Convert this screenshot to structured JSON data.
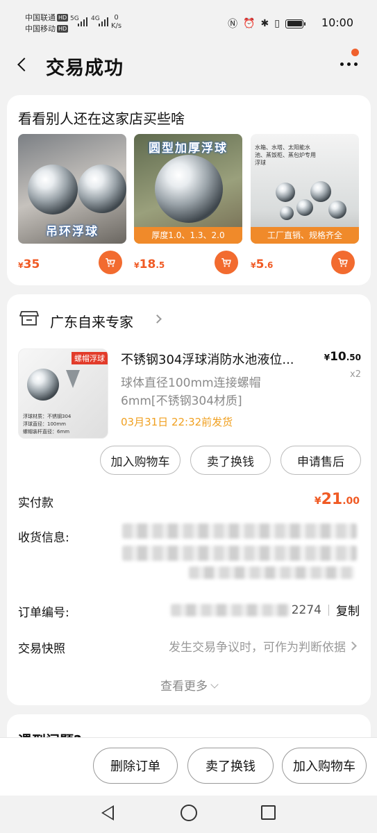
{
  "status_bar": {
    "carrier1": "中国联通",
    "carrier2": "中国移动",
    "hd": "HD",
    "net1": "5G",
    "net2": "4G",
    "speed_value": "0",
    "speed_unit": "K/s",
    "time": "10:00",
    "icons": [
      "nfc-icon",
      "alarm-icon",
      "bluetooth-icon",
      "vibrate-icon",
      "battery-icon"
    ]
  },
  "header": {
    "title": "交易成功",
    "back_icon": "back-chevron-icon",
    "more_icon": "more-dots-icon"
  },
  "recommend": {
    "title": "看看别人还在这家店买些啥",
    "products": [
      {
        "image_label": "吊环浮球",
        "price_symbol": "¥",
        "price_int": "35",
        "price_dec": ""
      },
      {
        "image_label": "圆型加厚浮球",
        "image_strip": "厚度1.0、1.3、2.0",
        "price_symbol": "¥",
        "price_int": "18",
        "price_dec": ".5"
      },
      {
        "image_label": "水箱、水塔、太阳能水池、蒸饭柜、蒸包炉专用浮球",
        "image_strip": "工厂直销、规格齐全",
        "price_symbol": "¥",
        "price_int": "5",
        "price_dec": ".6"
      }
    ]
  },
  "order": {
    "shop_name": "广东自来专家",
    "item": {
      "badge": "螺帽浮球",
      "title": "不锈钢304浮球消防水池液位...",
      "price_symbol": "¥",
      "price_int": "10",
      "price_dec": ".50",
      "qty": "x2",
      "spec": "球体直径100mm连接螺帽6mm[不锈钢304材质]",
      "ship": "03月31日 22:32前发货",
      "img_lines": [
        "浮球材质：不锈钢304",
        "浮球直径：100mm",
        "螺帽装杆直径：6mm"
      ]
    },
    "actions": [
      "加入购物车",
      "卖了换钱",
      "申请售后"
    ],
    "paid_label": "实付款",
    "paid_symbol": "¥",
    "paid_int": "21",
    "paid_dec": ".00",
    "address_label": "收货信息:",
    "order_no_label": "订单编号:",
    "order_no_tail": "2274",
    "copy_label": "复制",
    "snapshot_label": "交易快照",
    "snapshot_desc": "发生交易争议时，可作为判断依据",
    "see_more": "查看更多"
  },
  "next_card": {
    "partial_title": "遇到问题?"
  },
  "bottom_bar": {
    "buttons": [
      "删除订单",
      "卖了换钱",
      "加入购物车"
    ]
  },
  "colors": {
    "accent": "#f05a24",
    "cart_button": "#f26b2f",
    "ship_text": "#f0a020",
    "background": "#f2f2f2"
  }
}
